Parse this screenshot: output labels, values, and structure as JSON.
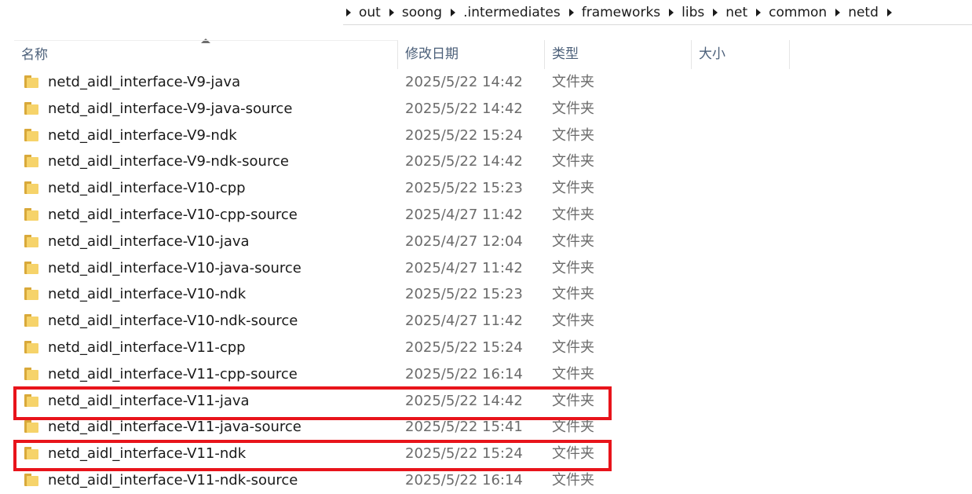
{
  "breadcrumb": [
    "out",
    "soong",
    ".intermediates",
    "frameworks",
    "libs",
    "net",
    "common",
    "netd"
  ],
  "columns": {
    "name": "名称",
    "date": "修改日期",
    "type": "类型",
    "size": "大小"
  },
  "files": [
    {
      "name": "netd_aidl_interface-V9-java",
      "date": "2025/5/22 14:42",
      "type": "文件夹"
    },
    {
      "name": "netd_aidl_interface-V9-java-source",
      "date": "2025/5/22 14:42",
      "type": "文件夹"
    },
    {
      "name": "netd_aidl_interface-V9-ndk",
      "date": "2025/5/22 15:24",
      "type": "文件夹"
    },
    {
      "name": "netd_aidl_interface-V9-ndk-source",
      "date": "2025/5/22 14:42",
      "type": "文件夹"
    },
    {
      "name": "netd_aidl_interface-V10-cpp",
      "date": "2025/5/22 15:23",
      "type": "文件夹"
    },
    {
      "name": "netd_aidl_interface-V10-cpp-source",
      "date": "2025/4/27 11:42",
      "type": "文件夹"
    },
    {
      "name": "netd_aidl_interface-V10-java",
      "date": "2025/4/27 12:04",
      "type": "文件夹"
    },
    {
      "name": "netd_aidl_interface-V10-java-source",
      "date": "2025/4/27 11:42",
      "type": "文件夹"
    },
    {
      "name": "netd_aidl_interface-V10-ndk",
      "date": "2025/5/22 15:23",
      "type": "文件夹"
    },
    {
      "name": "netd_aidl_interface-V10-ndk-source",
      "date": "2025/4/27 11:42",
      "type": "文件夹"
    },
    {
      "name": "netd_aidl_interface-V11-cpp",
      "date": "2025/5/22 15:24",
      "type": "文件夹"
    },
    {
      "name": "netd_aidl_interface-V11-cpp-source",
      "date": "2025/5/22 16:14",
      "type": "文件夹"
    },
    {
      "name": "netd_aidl_interface-V11-java",
      "date": "2025/5/22 14:42",
      "type": "文件夹"
    },
    {
      "name": "netd_aidl_interface-V11-java-source",
      "date": "2025/5/22 15:41",
      "type": "文件夹"
    },
    {
      "name": "netd_aidl_interface-V11-ndk",
      "date": "2025/5/22 15:24",
      "type": "文件夹"
    },
    {
      "name": "netd_aidl_interface-V11-ndk-source",
      "date": "2025/5/22 16:14",
      "type": "文件夹"
    }
  ],
  "colors": {
    "highlight": "#e8141b",
    "folder_front": "#f6d36a",
    "folder_back": "#d9a93a",
    "header_text": "#4c607a"
  }
}
